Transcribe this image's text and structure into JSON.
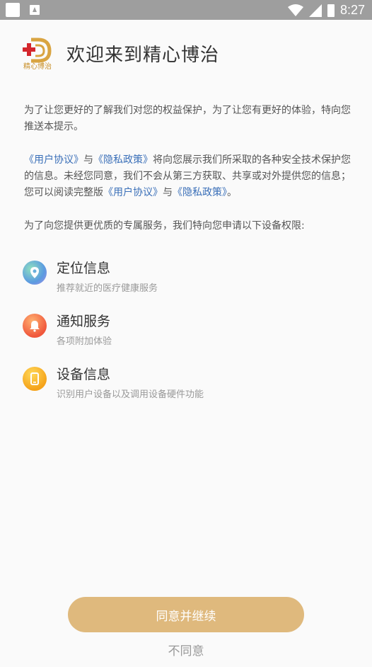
{
  "statusbar": {
    "time": "8:27"
  },
  "header": {
    "title": "欢迎来到精心博治",
    "logo_text": "精心博治"
  },
  "intro": {
    "p1": "为了让您更好的了解我们对您的权益保护，为了让您有更好的体验，特向您推送本提示。",
    "p2_link1": "《用户协议》",
    "p2_and1": "与",
    "p2_link2": "《隐私政策》",
    "p2_text": "将向您展示我们所采取的各种安全技术保护您的信息。未经您同意，我们不会从第三方获取、共享或对外提供您的信息；您可以阅读完整版",
    "p2_link3": "《用户协议》",
    "p2_and2": "与",
    "p2_link4": "《隐私政策》",
    "p2_end": "。",
    "p3": "为了向您提供更优质的专属服务，我们特向您申请以下设备权限:"
  },
  "permissions": [
    {
      "title": "定位信息",
      "desc": "推荐就近的医疗健康服务",
      "icon": "location-icon"
    },
    {
      "title": "通知服务",
      "desc": "各项附加体验",
      "icon": "bell-icon"
    },
    {
      "title": "设备信息",
      "desc": "识别用户设备以及调用设备硬件功能",
      "icon": "phone-icon"
    }
  ],
  "buttons": {
    "agree": "同意并继续",
    "disagree": "不同意"
  },
  "colors": {
    "accent": "#dfb97d",
    "link": "#3a6fb8",
    "logo_red": "#d4262c",
    "logo_gold": "#d9a441"
  }
}
